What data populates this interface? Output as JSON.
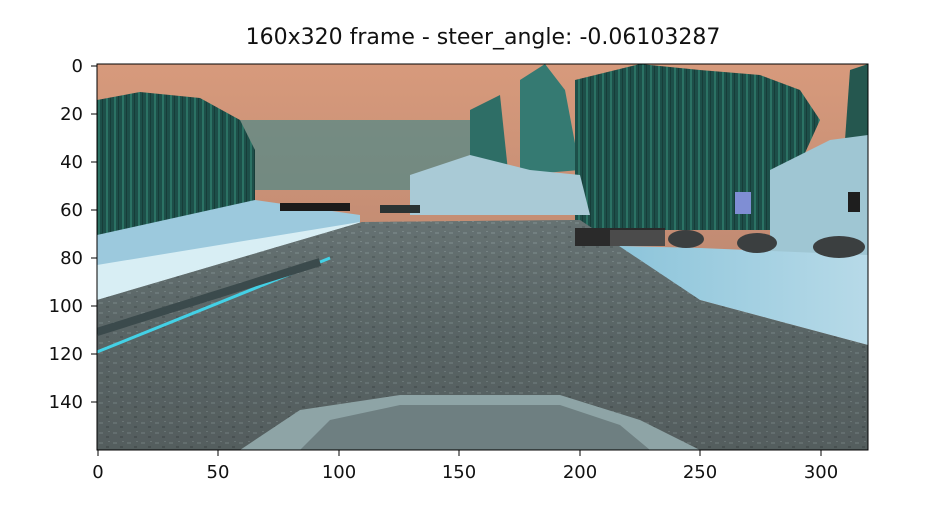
{
  "title": "160x320 frame - steer_angle: -0.06103287",
  "axes": {
    "x_ticks": [
      "0",
      "50",
      "100",
      "150",
      "200",
      "250",
      "300"
    ],
    "y_ticks": [
      "0",
      "20",
      "40",
      "60",
      "80",
      "100",
      "120",
      "140"
    ]
  },
  "image": {
    "description_colors": {
      "sky": "#c88a6c",
      "trees": "#1f5a52",
      "snow": "#a7d0df",
      "road": "#5a6565",
      "road_edge_line": "#43d1e6",
      "hood": "#8aa0a4"
    }
  }
}
